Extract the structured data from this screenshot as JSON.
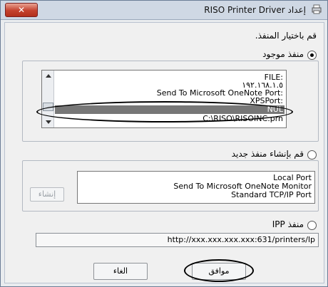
{
  "titlebar": {
    "title": "إعداد RISO Printer Driver",
    "close_glyph": "✕",
    "icon": "printer-app-icon"
  },
  "instruction": "قم باختيار المنفذ.",
  "existing_port": {
    "label": "منفذ موجود",
    "selected": true,
    "items": [
      "FILE:",
      "١٩٢.١٦٨.١.٥",
      "Send To Microsoft OneNote Port:",
      "XPSPort:",
      "NUL",
      "C:\\RISO\\RISOINC.prn"
    ],
    "selected_item": "NUL"
  },
  "new_port": {
    "label": "قم بإنشاء منفذ جديد",
    "selected": false,
    "items": [
      "Local Port",
      "Send To Microsoft OneNote Monitor",
      "Standard TCP/IP Port"
    ],
    "create_button": "إنشاء"
  },
  "ipp_port": {
    "label": "منفذ IPP",
    "selected": false,
    "url": "http://xxx.xxx.xxx.xxx:631/printers/lp"
  },
  "buttons": {
    "ok": "موافق",
    "cancel": "الغاء"
  },
  "colors": {
    "selection": "#777777",
    "annotation": "#000000"
  }
}
